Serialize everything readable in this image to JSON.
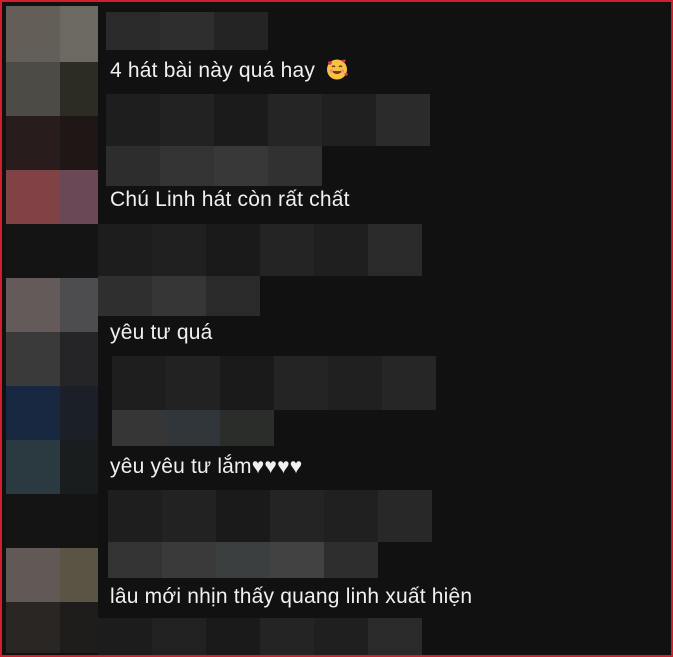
{
  "comments": [
    {
      "text": "4 hát bài này quá hay",
      "emoji": "smiling-face-with-hearts-icon"
    },
    {
      "text": "Chú Linh hát còn rất chất"
    },
    {
      "text": "yêu tư quá"
    },
    {
      "text": "yêu yêu tư lắm♥♥♥♥"
    },
    {
      "text": "lâu mới nhịn thấy quang linh xuất hiện"
    }
  ],
  "colors": {
    "frame_border": "#d21f2b",
    "background": "#111111",
    "text": "#f0f0f0"
  }
}
